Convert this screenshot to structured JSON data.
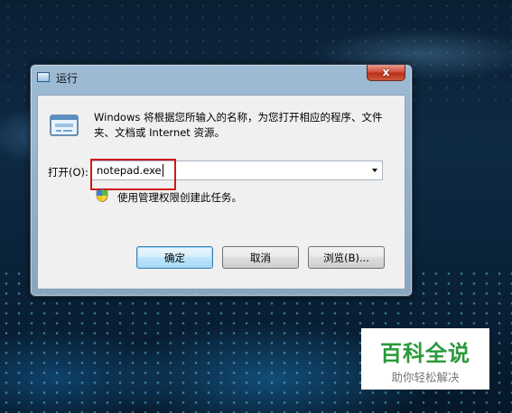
{
  "window": {
    "title": "运行",
    "close_label": "x"
  },
  "dialog": {
    "description": "Windows 将根据您所输入的名称，为您打开相应的程序、文件夹、文档或 Internet 资源。",
    "open_label": "打开(O):",
    "open_value": "notepad.exe",
    "admin_note": "使用管理权限创建此任务。"
  },
  "buttons": {
    "ok": "确定",
    "cancel": "取消",
    "browse": "浏览(B)..."
  },
  "watermark": {
    "main": "百科全说",
    "sub": "助你轻松解决"
  },
  "colors": {
    "highlight_box": "#d01818",
    "logo_green": "#2a9a3a",
    "close_button": "#c8412d"
  }
}
